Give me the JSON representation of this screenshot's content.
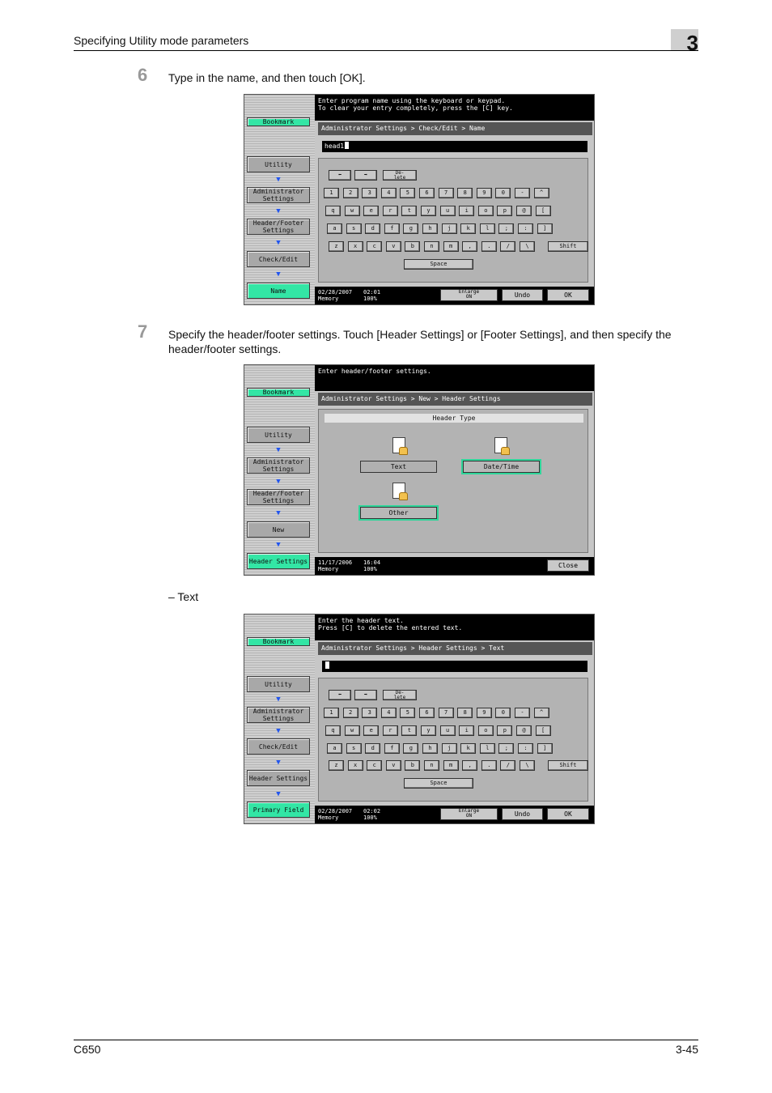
{
  "header": {
    "title": "Specifying Utility mode parameters",
    "chapter": "3"
  },
  "step6": {
    "number": "6",
    "text": "Type in the name, and then touch [OK]."
  },
  "step7": {
    "number": "7",
    "text": "Specify the header/footer settings. Touch [Header Settings] or [Footer Settings], and then specify the header/footer settings."
  },
  "dash_item": "–  Text",
  "footer": {
    "model": "C650",
    "page": "3-45"
  },
  "keyboard": {
    "row1": [
      "1",
      "2",
      "3",
      "4",
      "5",
      "6",
      "7",
      "8",
      "9",
      "0",
      "-",
      "^"
    ],
    "row2": [
      "q",
      "w",
      "e",
      "r",
      "t",
      "y",
      "u",
      "i",
      "o",
      "p",
      "@",
      "["
    ],
    "row3": [
      "a",
      "s",
      "d",
      "f",
      "g",
      "h",
      "j",
      "k",
      "l",
      ";",
      ":",
      "]"
    ],
    "row4": [
      "z",
      "x",
      "c",
      "v",
      "b",
      "n",
      "m",
      ",",
      ".",
      "/",
      "\\"
    ],
    "shift": "Shift",
    "space": "Space",
    "left": "⬅",
    "right": "➡",
    "delete": "De-\nlete"
  },
  "screen1": {
    "message": "Enter program name using the keyboard or keypad.\nTo clear your entry completely, press the [C] key.",
    "sidebar": [
      "Bookmark",
      "Utility",
      "Administrator\nSettings",
      "Header/Footer\nSettings",
      "Check/Edit",
      "Name"
    ],
    "breadcrumb": "Administrator Settings > Check/Edit > Name",
    "input_value": "head1",
    "date": "02/28/2007",
    "time": "02:01",
    "memory": "Memory",
    "percent": "100%",
    "enlarge": "Enlarge\nON",
    "undo": "Undo",
    "ok": "OK"
  },
  "screen2": {
    "message": "Enter header/footer settings.",
    "sidebar": [
      "Bookmark",
      "Utility",
      "Administrator\nSettings",
      "Header/Footer\nSettings",
      "New",
      "Header Settings"
    ],
    "breadcrumb": "Administrator Settings > New > Header Settings",
    "header_type": "Header Type",
    "options": [
      "Text",
      "Date/Time",
      "Other"
    ],
    "date": "11/17/2006",
    "time": "16:04",
    "memory": "Memory",
    "percent": "100%",
    "close": "Close"
  },
  "screen3": {
    "message": "Enter the header text.\nPress [C] to delete the entered text.",
    "sidebar": [
      "Bookmark",
      "Utility",
      "Administrator\nSettings",
      "Check/Edit",
      "Header Settings",
      "Primary Field"
    ],
    "breadcrumb": "Administrator Settings > Header Settings > Text",
    "input_value": "",
    "date": "02/28/2007",
    "time": "02:02",
    "memory": "Memory",
    "percent": "100%",
    "enlarge": "Enlarge\nON",
    "undo": "Undo",
    "ok": "OK"
  },
  "colors": {
    "accent_green": "#33e6a5",
    "arrow_blue": "#2255ee"
  }
}
